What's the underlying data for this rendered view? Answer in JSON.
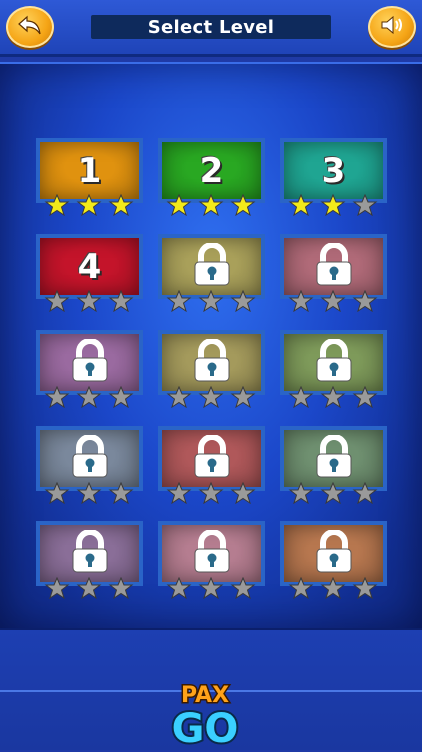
{
  "header": {
    "title": "Select Level",
    "back_icon": "back-arrow-icon",
    "sound_icon": "speaker-icon"
  },
  "levels": [
    {
      "label": "1",
      "locked": false,
      "stars": 3,
      "color": "#e0920f"
    },
    {
      "label": "2",
      "locked": false,
      "stars": 3,
      "color": "#29a822"
    },
    {
      "label": "3",
      "locked": false,
      "stars": 2,
      "color": "#1fa592"
    },
    {
      "label": "4",
      "locked": false,
      "stars": 0,
      "color": "#c4142a"
    },
    {
      "label": "",
      "locked": true,
      "stars": 0,
      "color": "#a9a05a"
    },
    {
      "label": "",
      "locked": true,
      "stars": 0,
      "color": "#b06a78"
    },
    {
      "label": "",
      "locked": true,
      "stars": 0,
      "color": "#9a6aa0"
    },
    {
      "label": "",
      "locked": true,
      "stars": 0,
      "color": "#a49a5c"
    },
    {
      "label": "",
      "locked": true,
      "stars": 0,
      "color": "#7e9a5a"
    },
    {
      "label": "",
      "locked": true,
      "stars": 0,
      "color": "#7a889c"
    },
    {
      "label": "",
      "locked": true,
      "stars": 0,
      "color": "#b0585a"
    },
    {
      "label": "",
      "locked": true,
      "stars": 0,
      "color": "#6f9070"
    },
    {
      "label": "",
      "locked": true,
      "stars": 0,
      "color": "#8a6e98"
    },
    {
      "label": "",
      "locked": true,
      "stars": 0,
      "color": "#b57d90"
    },
    {
      "label": "",
      "locked": true,
      "stars": 0,
      "color": "#b7774f"
    }
  ],
  "colors": {
    "star_on": "#f3ea1a",
    "star_off": "#9a9a9a",
    "lock": "#ffffff"
  },
  "logo": {
    "line1": "PAX",
    "line2": "GO"
  }
}
